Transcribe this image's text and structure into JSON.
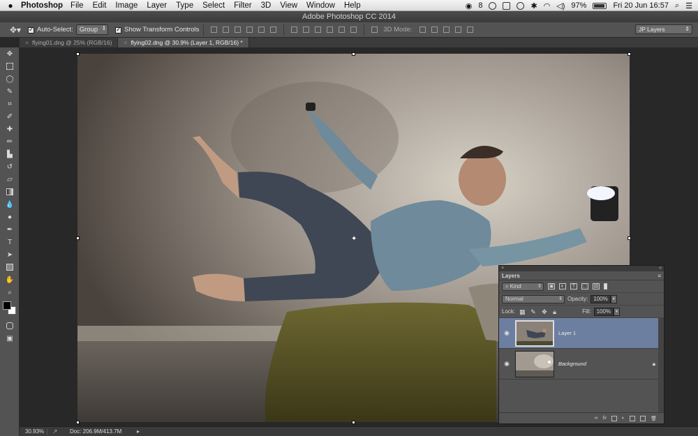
{
  "menubar": {
    "app_name": "Photoshop",
    "items": [
      "File",
      "Edit",
      "Image",
      "Layer",
      "Type",
      "Select",
      "Filter",
      "3D",
      "View",
      "Window",
      "Help"
    ],
    "badge": "8",
    "battery": "97%",
    "clock": "Fri 20 Jun  16:57"
  },
  "window": {
    "title": "Adobe Photoshop CC 2014"
  },
  "options": {
    "auto_select_label": "Auto-Select:",
    "auto_select_value": "Group",
    "transform_label": "Show Transform Controls",
    "mode_3d_label": "3D Mode:",
    "workspace": "JP Layers"
  },
  "tabs": [
    {
      "label": "flying01.dng @ 25% (RGB/16)",
      "active": false
    },
    {
      "label": "flying02.dng @ 30.9% (Layer 1, RGB/16) *",
      "active": true
    }
  ],
  "status": {
    "zoom": "30.93%",
    "doc": "Doc: 206.9M/413.7M"
  },
  "layers_panel": {
    "title": "Layers",
    "filter_kind": "Kind",
    "blend_mode": "Normal",
    "opacity_label": "Opacity:",
    "opacity_value": "100%",
    "lock_label": "Lock:",
    "fill_label": "Fill:",
    "fill_value": "100%",
    "layers": [
      {
        "name": "Layer 1",
        "selected": true
      },
      {
        "name": "Background",
        "selected": false,
        "locked": true
      }
    ]
  }
}
